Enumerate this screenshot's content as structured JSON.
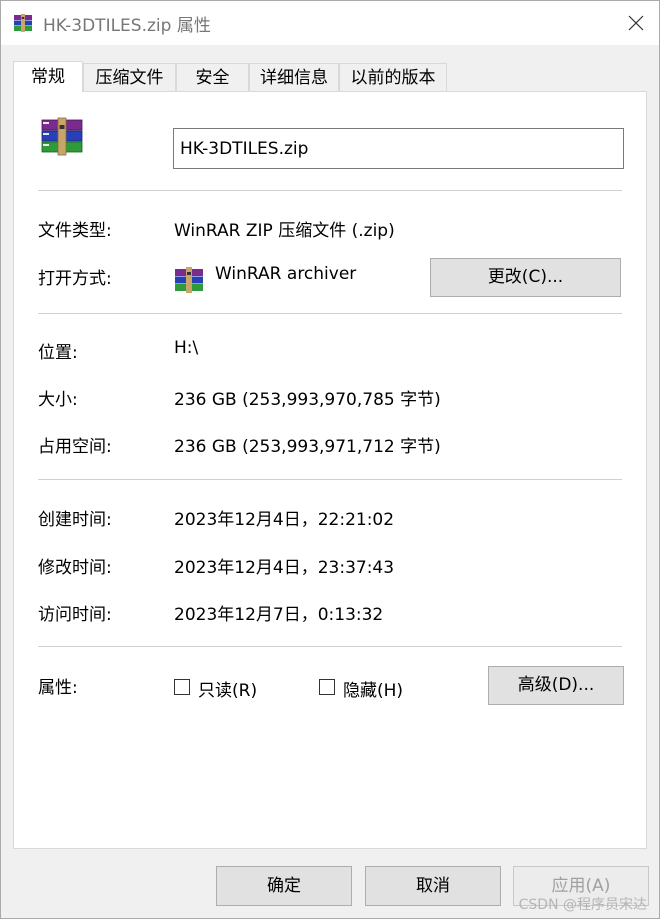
{
  "window": {
    "title": "HK-3DTILES.zip 属性"
  },
  "icons": {
    "app": "winrar-books-icon",
    "close": "close-icon"
  },
  "tabs": [
    {
      "label": "常规",
      "active": true
    },
    {
      "label": "压缩文件",
      "active": false
    },
    {
      "label": "安全",
      "active": false
    },
    {
      "label": "详细信息",
      "active": false
    },
    {
      "label": "以前的版本",
      "active": false
    }
  ],
  "general": {
    "file_name": "HK-3DTILES.zip",
    "file_type_label": "文件类型:",
    "file_type_value": "WinRAR ZIP 压缩文件 (.zip)",
    "open_with_label": "打开方式:",
    "open_with_value": "WinRAR archiver",
    "change_button": "更改(C)...",
    "location_label": "位置:",
    "location_value": "H:\\",
    "size_label": "大小:",
    "size_value": "236 GB (253,993,970,785 字节)",
    "disk_size_label": "占用空间:",
    "disk_size_value": "236 GB (253,993,971,712 字节)",
    "created_label": "创建时间:",
    "created_value": "2023年12月4日，22:21:02",
    "modified_label": "修改时间:",
    "modified_value": "2023年12月4日，23:37:43",
    "accessed_label": "访问时间:",
    "accessed_value": "2023年12月7日，0:13:32",
    "attributes_label": "属性:",
    "readonly_label": "只读(R)",
    "readonly_checked": false,
    "hidden_label": "隐藏(H)",
    "hidden_checked": false,
    "advanced_button": "高级(D)..."
  },
  "footer": {
    "ok_button": "确定",
    "cancel_button": "取消",
    "apply_button": "应用(A)",
    "apply_enabled": false
  },
  "watermark": "CSDN @程序员宋达"
}
